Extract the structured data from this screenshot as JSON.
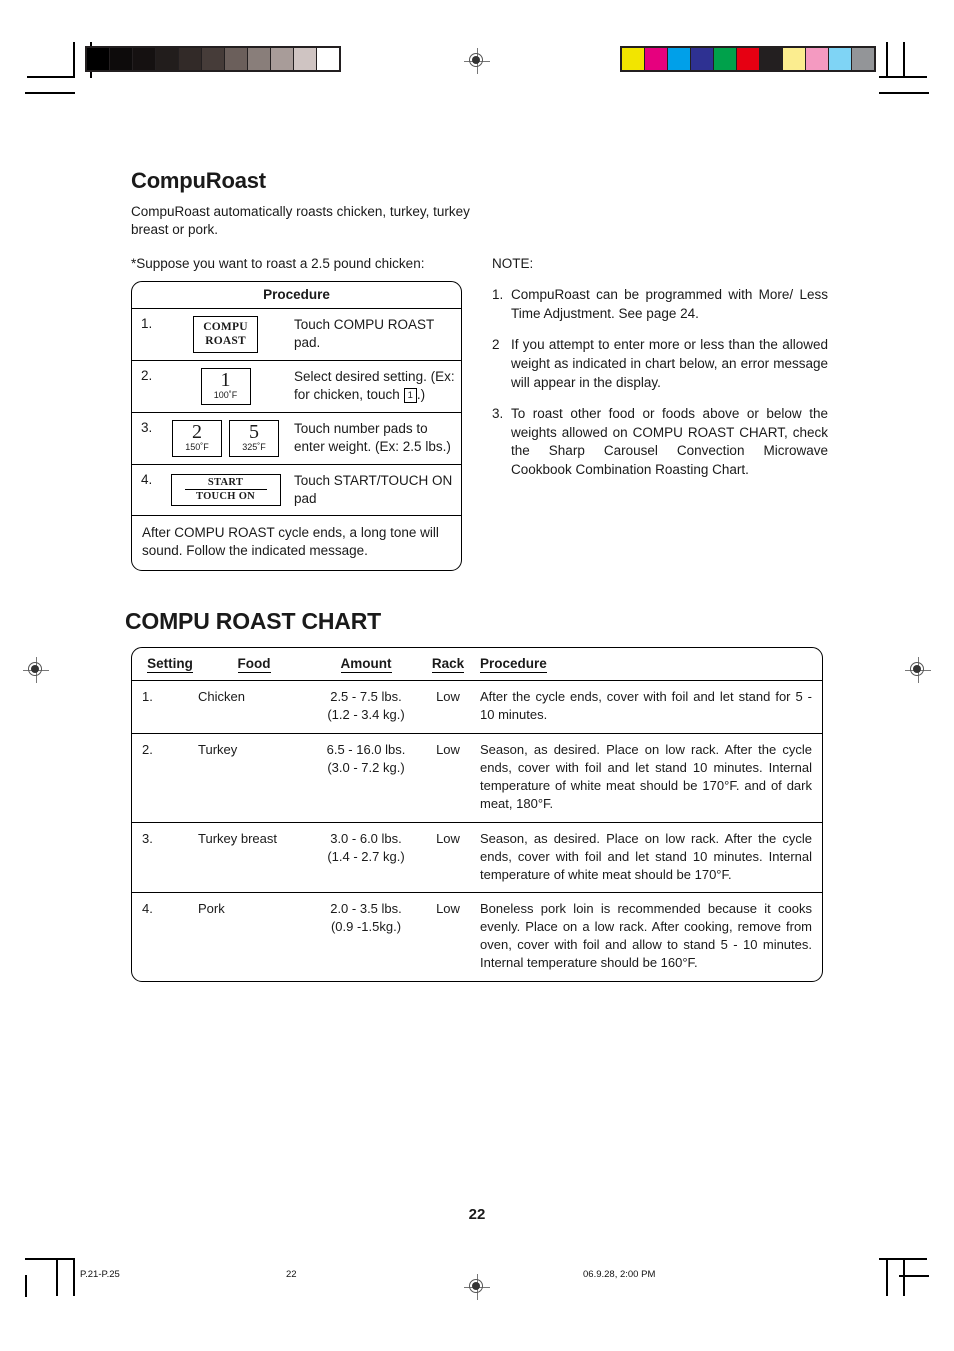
{
  "document": {
    "page_number": "22",
    "footer": {
      "left": "P.21-P.25",
      "center": "22",
      "right": "06.9.28, 2:00 PM"
    }
  },
  "calibration": {
    "gray_bar": [
      "#000000",
      "#0d0b0b",
      "#151111",
      "#221d1c",
      "#322a28",
      "#463c39",
      "#6b5f5b",
      "#897e7a",
      "#a89c99",
      "#cfc4c2",
      "#ffffff"
    ],
    "color_bar": [
      "#f2e500",
      "#e6007e",
      "#00a0e9",
      "#2e3192",
      "#00a14b",
      "#e60012",
      "#231f20",
      "#fbed8f",
      "#f49ac1",
      "#7fd4f5",
      "#939598"
    ]
  },
  "section": {
    "title": "CompuRoast",
    "intro": "CompuRoast automatically roasts chicken, turkey, turkey breast or pork.",
    "suppose": "*Suppose you want to roast a 2.5 pound chicken:"
  },
  "procedure_table": {
    "header": "Procedure",
    "steps": [
      {
        "num": "1.",
        "pads": [
          {
            "type": "text",
            "line1": "COMPU",
            "line2": "ROAST"
          }
        ],
        "desc": "Touch COMPU ROAST pad."
      },
      {
        "num": "2.",
        "pads": [
          {
            "type": "number",
            "digit": "1",
            "temp": "100˚F"
          }
        ],
        "desc_part1": "Select desired setting. (Ex: for chicken, touch ",
        "desc_key": "1",
        "desc_part2": ".)"
      },
      {
        "num": "3.",
        "pads": [
          {
            "type": "number",
            "digit": "2",
            "temp": "150˚F"
          },
          {
            "type": "number",
            "digit": "5",
            "temp": "325˚F"
          }
        ],
        "desc": "Touch number pads to enter weight. (Ex: 2.5 lbs.)"
      },
      {
        "num": "4.",
        "pads": [
          {
            "type": "start",
            "line1": "START",
            "line2": "TOUCH ON"
          }
        ],
        "desc": "Touch START/TOUCH ON pad"
      }
    ],
    "footer_note": "After COMPU ROAST cycle ends, a long tone will sound. Follow the indicated message."
  },
  "note": {
    "label": "NOTE:",
    "items": [
      {
        "marker": "1.",
        "text": "CompuRoast can be programmed with More/ Less Time Adjustment. See page 24."
      },
      {
        "marker": "2",
        "text": "If you attempt to enter  more or less than the allowed weight as indicated in chart below, an error message will appear in the display."
      },
      {
        "marker": "3.",
        "text": "To roast other food or foods above or below the weights allowed on COMPU ROAST CHART, check the Sharp Carousel Convection Microwave Cookbook Combination Roasting Chart."
      }
    ]
  },
  "chart": {
    "title": "COMPU ROAST CHART",
    "columns": [
      "Setting",
      "Food",
      "Amount",
      "Rack",
      "Procedure"
    ],
    "rows": [
      {
        "setting": "1.",
        "food": "Chicken",
        "amount_lbs": "2.5 - 7.5 lbs.",
        "amount_kg": "(1.2 - 3.4 kg.)",
        "rack": "Low",
        "procedure": "After  the  cycle  ends, cover with foil  and  let stand for 5 - 10 minutes."
      },
      {
        "setting": "2.",
        "food": "Turkey",
        "amount_lbs": "6.5 - 16.0 lbs.",
        "amount_kg": "(3.0 - 7.2 kg.)",
        "rack": "Low",
        "procedure": "Season, as desired. Place on low rack. After the cycle ends, cover with foil and let stand 10 minutes. Internal temperature of white meat should be 170°F. and of dark meat, 180°F."
      },
      {
        "setting": "3.",
        "food": "Turkey breast",
        "amount_lbs": "3.0 - 6.0 lbs.",
        "amount_kg": "(1.4 - 2.7 kg.)",
        "rack": "Low",
        "procedure": "Season, as desired. Place on low rack. After the cycle ends, cover with foil and let stand 10 minutes. Internal temperature of white meat should be 170°F."
      },
      {
        "setting": "4.",
        "food": "Pork",
        "amount_lbs": "2.0 - 3.5 lbs.",
        "amount_kg": "(0.9 -1.5kg.)",
        "rack": "Low",
        "procedure": "Boneless  pork  loin  is recommended because it cooks evenly.    Place  on  a low  rack. After cooking, remove from oven, cover with foil and allow to stand  5 - 10  minutes. Internal temperature should be 160°F."
      }
    ]
  }
}
